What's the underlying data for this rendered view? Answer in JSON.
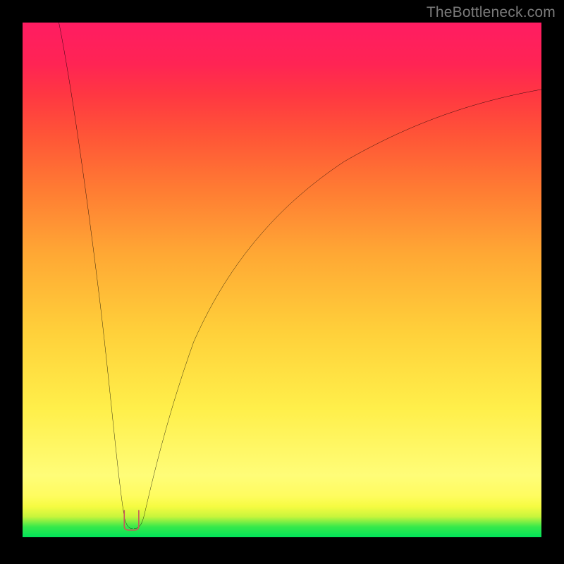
{
  "watermark": "TheBottleneck.com",
  "chart_data": {
    "type": "line",
    "title": "",
    "xlabel": "",
    "ylabel": "",
    "xlim": [
      0,
      100
    ],
    "ylim": [
      0,
      100
    ],
    "grid": false,
    "legend": false,
    "series": [
      {
        "name": "bottleneck-curve-left",
        "x": [
          7,
          8,
          10,
          12,
          14,
          16,
          17,
          18,
          19,
          19.5,
          20,
          21
        ],
        "values": [
          100,
          92,
          78,
          62,
          46,
          30,
          22,
          14,
          8,
          4,
          2,
          2
        ],
        "color": "#000000"
      },
      {
        "name": "bottleneck-curve-right",
        "x": [
          22,
          23,
          24,
          26,
          28,
          31,
          35,
          40,
          46,
          53,
          60,
          68,
          76,
          84,
          92,
          100
        ],
        "values": [
          2,
          2,
          4,
          10,
          18,
          28,
          38,
          48,
          56,
          63,
          69,
          74,
          78,
          81.5,
          84.5,
          87
        ],
        "color": "#000000"
      },
      {
        "name": "marker-bracket",
        "x": [
          19.5,
          19.5,
          22.3,
          22.3
        ],
        "values": [
          5.2,
          1.5,
          1.5,
          5.2
        ],
        "color": "#c95a5a"
      }
    ],
    "gradient_stops": [
      {
        "pos": 0,
        "color": "#00e35a"
      },
      {
        "pos": 6,
        "color": "#f6fb42"
      },
      {
        "pos": 12,
        "color": "#fffd78"
      },
      {
        "pos": 40,
        "color": "#ffd03a"
      },
      {
        "pos": 68,
        "color": "#ff7a33"
      },
      {
        "pos": 86,
        "color": "#ff3742"
      },
      {
        "pos": 100,
        "color": "#ff1c62"
      }
    ]
  }
}
